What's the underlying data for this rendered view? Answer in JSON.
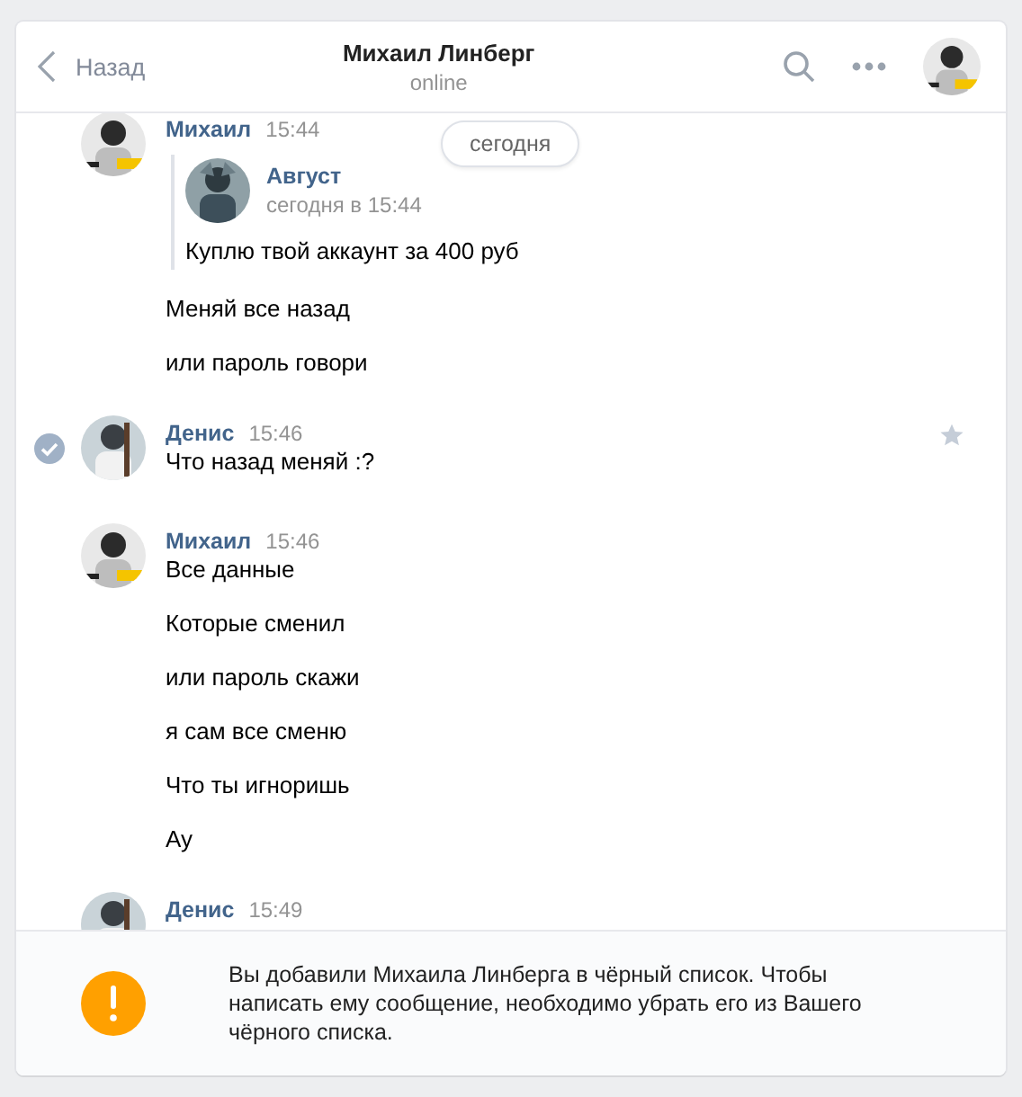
{
  "header": {
    "back": "Назад",
    "title": "Михаил Линберг",
    "status": "online"
  },
  "date_pill": "сегодня",
  "groups": [
    {
      "author": "Михаил",
      "time": "15:44",
      "selected": false,
      "messages": [
        {
          "kind": "forward",
          "author": "Август",
          "time": "сегодня в 15:44",
          "text": "Куплю твой аккаунт за 400 руб"
        },
        {
          "kind": "text",
          "text": "Меняй все назад"
        },
        {
          "kind": "text",
          "text": "или пароль говори"
        }
      ]
    },
    {
      "author": "Денис",
      "time": "15:46",
      "selected": true,
      "messages": [
        {
          "kind": "text",
          "text": "Что назад меняй :?"
        }
      ]
    },
    {
      "author": "Михаил",
      "time": "15:46",
      "selected": false,
      "messages": [
        {
          "kind": "text",
          "text": "Все данные"
        },
        {
          "kind": "text",
          "text": "Которые сменил"
        },
        {
          "kind": "text",
          "text": "или пароль скажи"
        },
        {
          "kind": "text",
          "text": "я сам все сменю"
        },
        {
          "kind": "text",
          "text": "Что ты игноришь"
        },
        {
          "kind": "text",
          "text": "Ау"
        }
      ]
    },
    {
      "author": "Денис",
      "time": "15:49",
      "selected": false
    }
  ],
  "notice": "Вы добавили Михаила Линберга в чёрный список. Чтобы написать ему сообщение, необходимо убрать его из Вашего чёрного списка."
}
